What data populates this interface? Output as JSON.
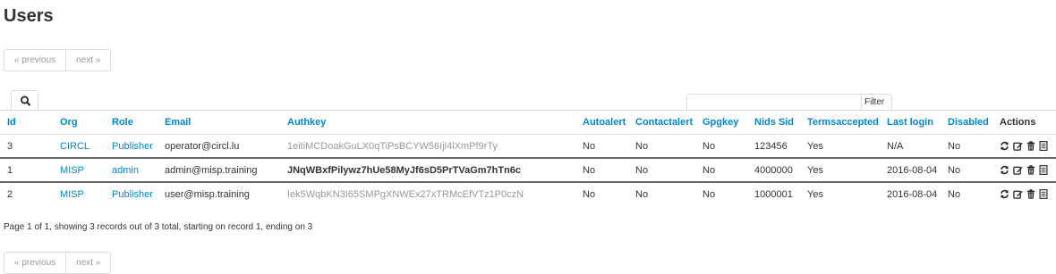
{
  "page": {
    "title": "Users"
  },
  "pagination": {
    "previous": "« previous",
    "next": "next »"
  },
  "filter": {
    "placeholder": "",
    "button": "Filter"
  },
  "columns": {
    "id": "Id",
    "org": "Org",
    "role": "Role",
    "email": "Email",
    "authkey": "Authkey",
    "autoalert": "Autoalert",
    "contactalert": "Contactalert",
    "gpgkey": "Gpgkey",
    "nids_sid": "Nids Sid",
    "termsaccepted": "Termsaccepted",
    "last_login": "Last login",
    "disabled": "Disabled",
    "actions": "Actions"
  },
  "rows": [
    {
      "id": "3",
      "org": "CIRCL",
      "role": "Publisher",
      "email": "operator@circl.lu",
      "authkey": "1eitiMCDoakGuLX0qTiPsBCYW56Ijl4lXmPf9rTy",
      "autoalert": "No",
      "contactalert": "No",
      "gpgkey": "No",
      "nids_sid": "123456",
      "termsaccepted": "Yes",
      "last_login": "N/A",
      "disabled": "No"
    },
    {
      "id": "1",
      "org": "MISP",
      "role": "admin",
      "email": "admin@misp.training",
      "authkey": "JNqWBxfPilywz7hUe58MyJf6sD5PrTVaGm7hTn6c",
      "autoalert": "No",
      "contactalert": "No",
      "gpgkey": "No",
      "nids_sid": "4000000",
      "termsaccepted": "Yes",
      "last_login": "2016-08-04",
      "disabled": "No"
    },
    {
      "id": "2",
      "org": "MISP",
      "role": "Publisher",
      "email": "user@misp.training",
      "authkey": "Iek5WqbKN3I65SMPgXNWEx27xTRMcEfVTz1P0czN",
      "autoalert": "No",
      "contactalert": "No",
      "gpgkey": "No",
      "nids_sid": "1000001",
      "termsaccepted": "Yes",
      "last_login": "2016-08-04",
      "disabled": "No"
    }
  ],
  "footer": {
    "summary": "Page 1 of 1, showing 3 records out of 3 total, starting on record 1, ending on 3"
  },
  "icons": {
    "search": "search-icon",
    "reset_key": "refresh-icon",
    "edit": "edit-icon",
    "delete": "trash-icon",
    "view": "list-icon"
  },
  "colors": {
    "link": "#0088cc",
    "muted": "#999999",
    "text": "#333333"
  }
}
